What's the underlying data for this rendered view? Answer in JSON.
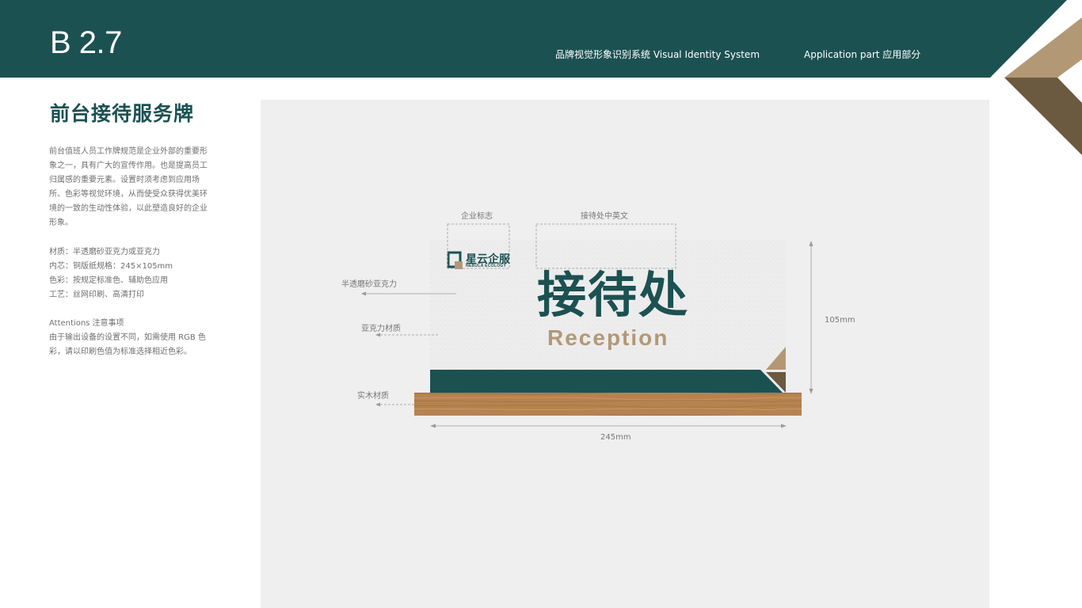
{
  "header": {
    "section_code": "B 2.7",
    "system_name": "品牌视觉形象识别系统   Visual Identity System",
    "part_name": "Application part  应用部分"
  },
  "title": "前台接待服务牌",
  "description": [
    "前台值班人员工作牌规范是企业外部的重要形象之一，具有广大的宣传作用。也是提高员工归属感的重要元素。设置时须考虑到应用场所、色彩等视觉环境，从而使受众获得优美环境的一致的生动性体验，以此塑造良好的企业形象。"
  ],
  "specs": [
    "材质：半透磨砂亚克力或亚克力",
    "内芯：铜版纸规格：245×105mm",
    "色彩：按规定标准色、辅助色应用",
    "工艺：丝网印刷、高清打印"
  ],
  "attentions": {
    "heading": "Attentions 注意事项",
    "text": "由于输出设备的设置不同，如需使用  RGB 色彩，请以印刷色值为标准选择相近色彩。"
  },
  "sign": {
    "logo_cn": "星云企服",
    "logo_en": "NEBULA ECOLOGY",
    "main_text": "接待处",
    "sub_text": "Reception"
  },
  "callouts": {
    "logo": "企业标志",
    "text_cn_en": "接待处中英文",
    "frosted_acrylic": "半透磨砂亚克力",
    "acrylic": "亚克力材质",
    "wood": "实木材质",
    "height": "105mm",
    "width": "245mm"
  },
  "colors": {
    "brand_green": "#1c5152",
    "brand_tan": "#b39876",
    "brand_brown": "#6b5a40",
    "wood": "#b5834f"
  }
}
